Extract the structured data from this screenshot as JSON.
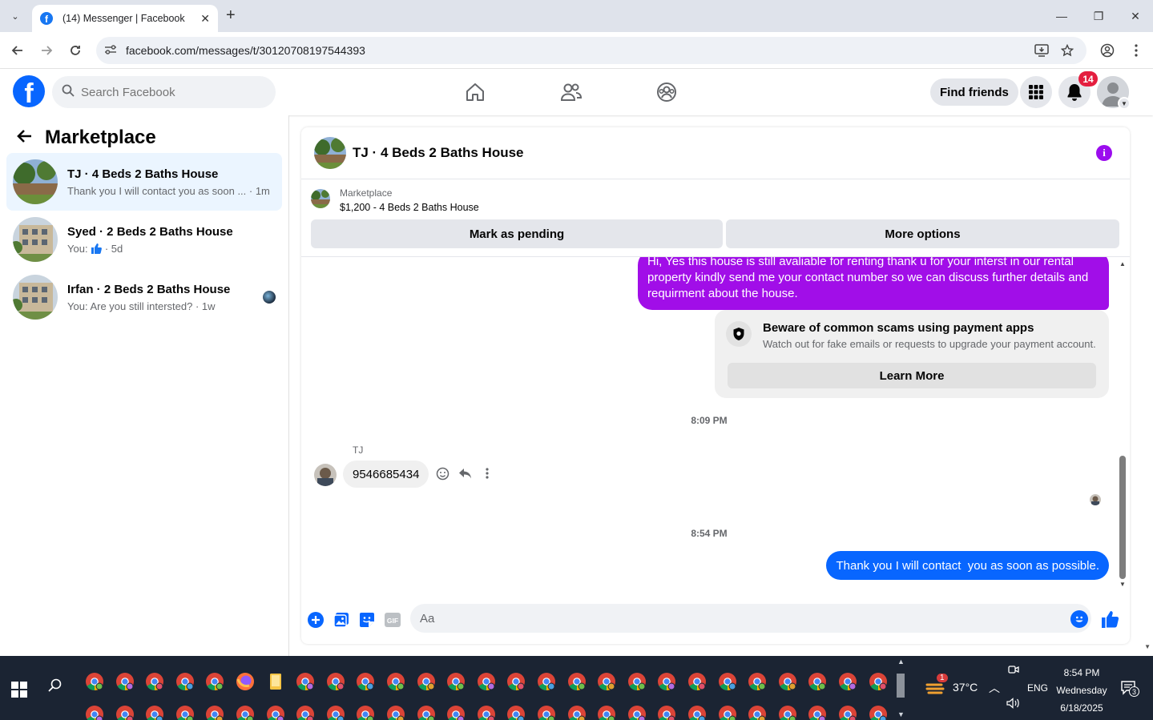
{
  "browser": {
    "tab_title": "(14) Messenger | Facebook",
    "tab_favicon": "f",
    "tab_close": "✕",
    "new_tab": "+",
    "url": "facebook.com/messages/t/30120708197544393",
    "window_controls": {
      "minimize": "—",
      "restore": "❐",
      "close": "✕"
    }
  },
  "header": {
    "logo_letter": "f",
    "search_placeholder": "Search Facebook",
    "find_friends_label": "Find friends",
    "notification_count": "14"
  },
  "sidebar": {
    "title": "Marketplace",
    "conversations": [
      {
        "name": "TJ · 4 Beds 2 Baths House",
        "preview": "Thank you I will contact you as soon ... · 1m",
        "active": true
      },
      {
        "name": "Syed · 2 Beds 2 Baths House",
        "preview_prefix": "You:",
        "preview_suffix": "· 5d",
        "active": false
      },
      {
        "name": "Irfan · 2 Beds 2 Baths House",
        "preview": "You: Are you still intersted? · 1w",
        "active": false
      }
    ]
  },
  "chat": {
    "title": "TJ · 4 Beds 2 Baths House",
    "info_label": "i",
    "marketplace": {
      "label": "Marketplace",
      "item": "$1,200 - 4 Beds 2 Baths House",
      "mark_pending_label": "Mark as pending",
      "more_options_label": "More options"
    },
    "messages": {
      "outgoing_1": "Hi, Yes this house is still avaliable for renting thank u for your interst in our rental property kindly send me your contact number so we can discuss further details and requirment about the house.",
      "scam_title": "Beware of common scams using payment apps",
      "scam_subtitle": "Watch out for fake emails or requests to upgrade your payment account.",
      "learn_more_label": "Learn More",
      "timestamp_1": "8:09 PM",
      "sender_name": "TJ",
      "incoming_1": "9546685434",
      "timestamp_2": "8:54 PM",
      "outgoing_2": "Thank you I will contact  you as soon as possible."
    },
    "composer_placeholder": "Aa"
  },
  "taskbar": {
    "temperature": "37°C",
    "weather_badge": "1",
    "language": "ENG",
    "time": "8:54 PM",
    "day": "Wednesday",
    "date": "6/18/2025",
    "notification_count": "3"
  },
  "colors": {
    "facebook_blue": "#0866ff",
    "outgoing_purple": "#a10ee8",
    "notification_red": "#e41e3f",
    "active_conversation_bg": "#ebf5ff",
    "taskbar_bg": "#1b2433"
  }
}
